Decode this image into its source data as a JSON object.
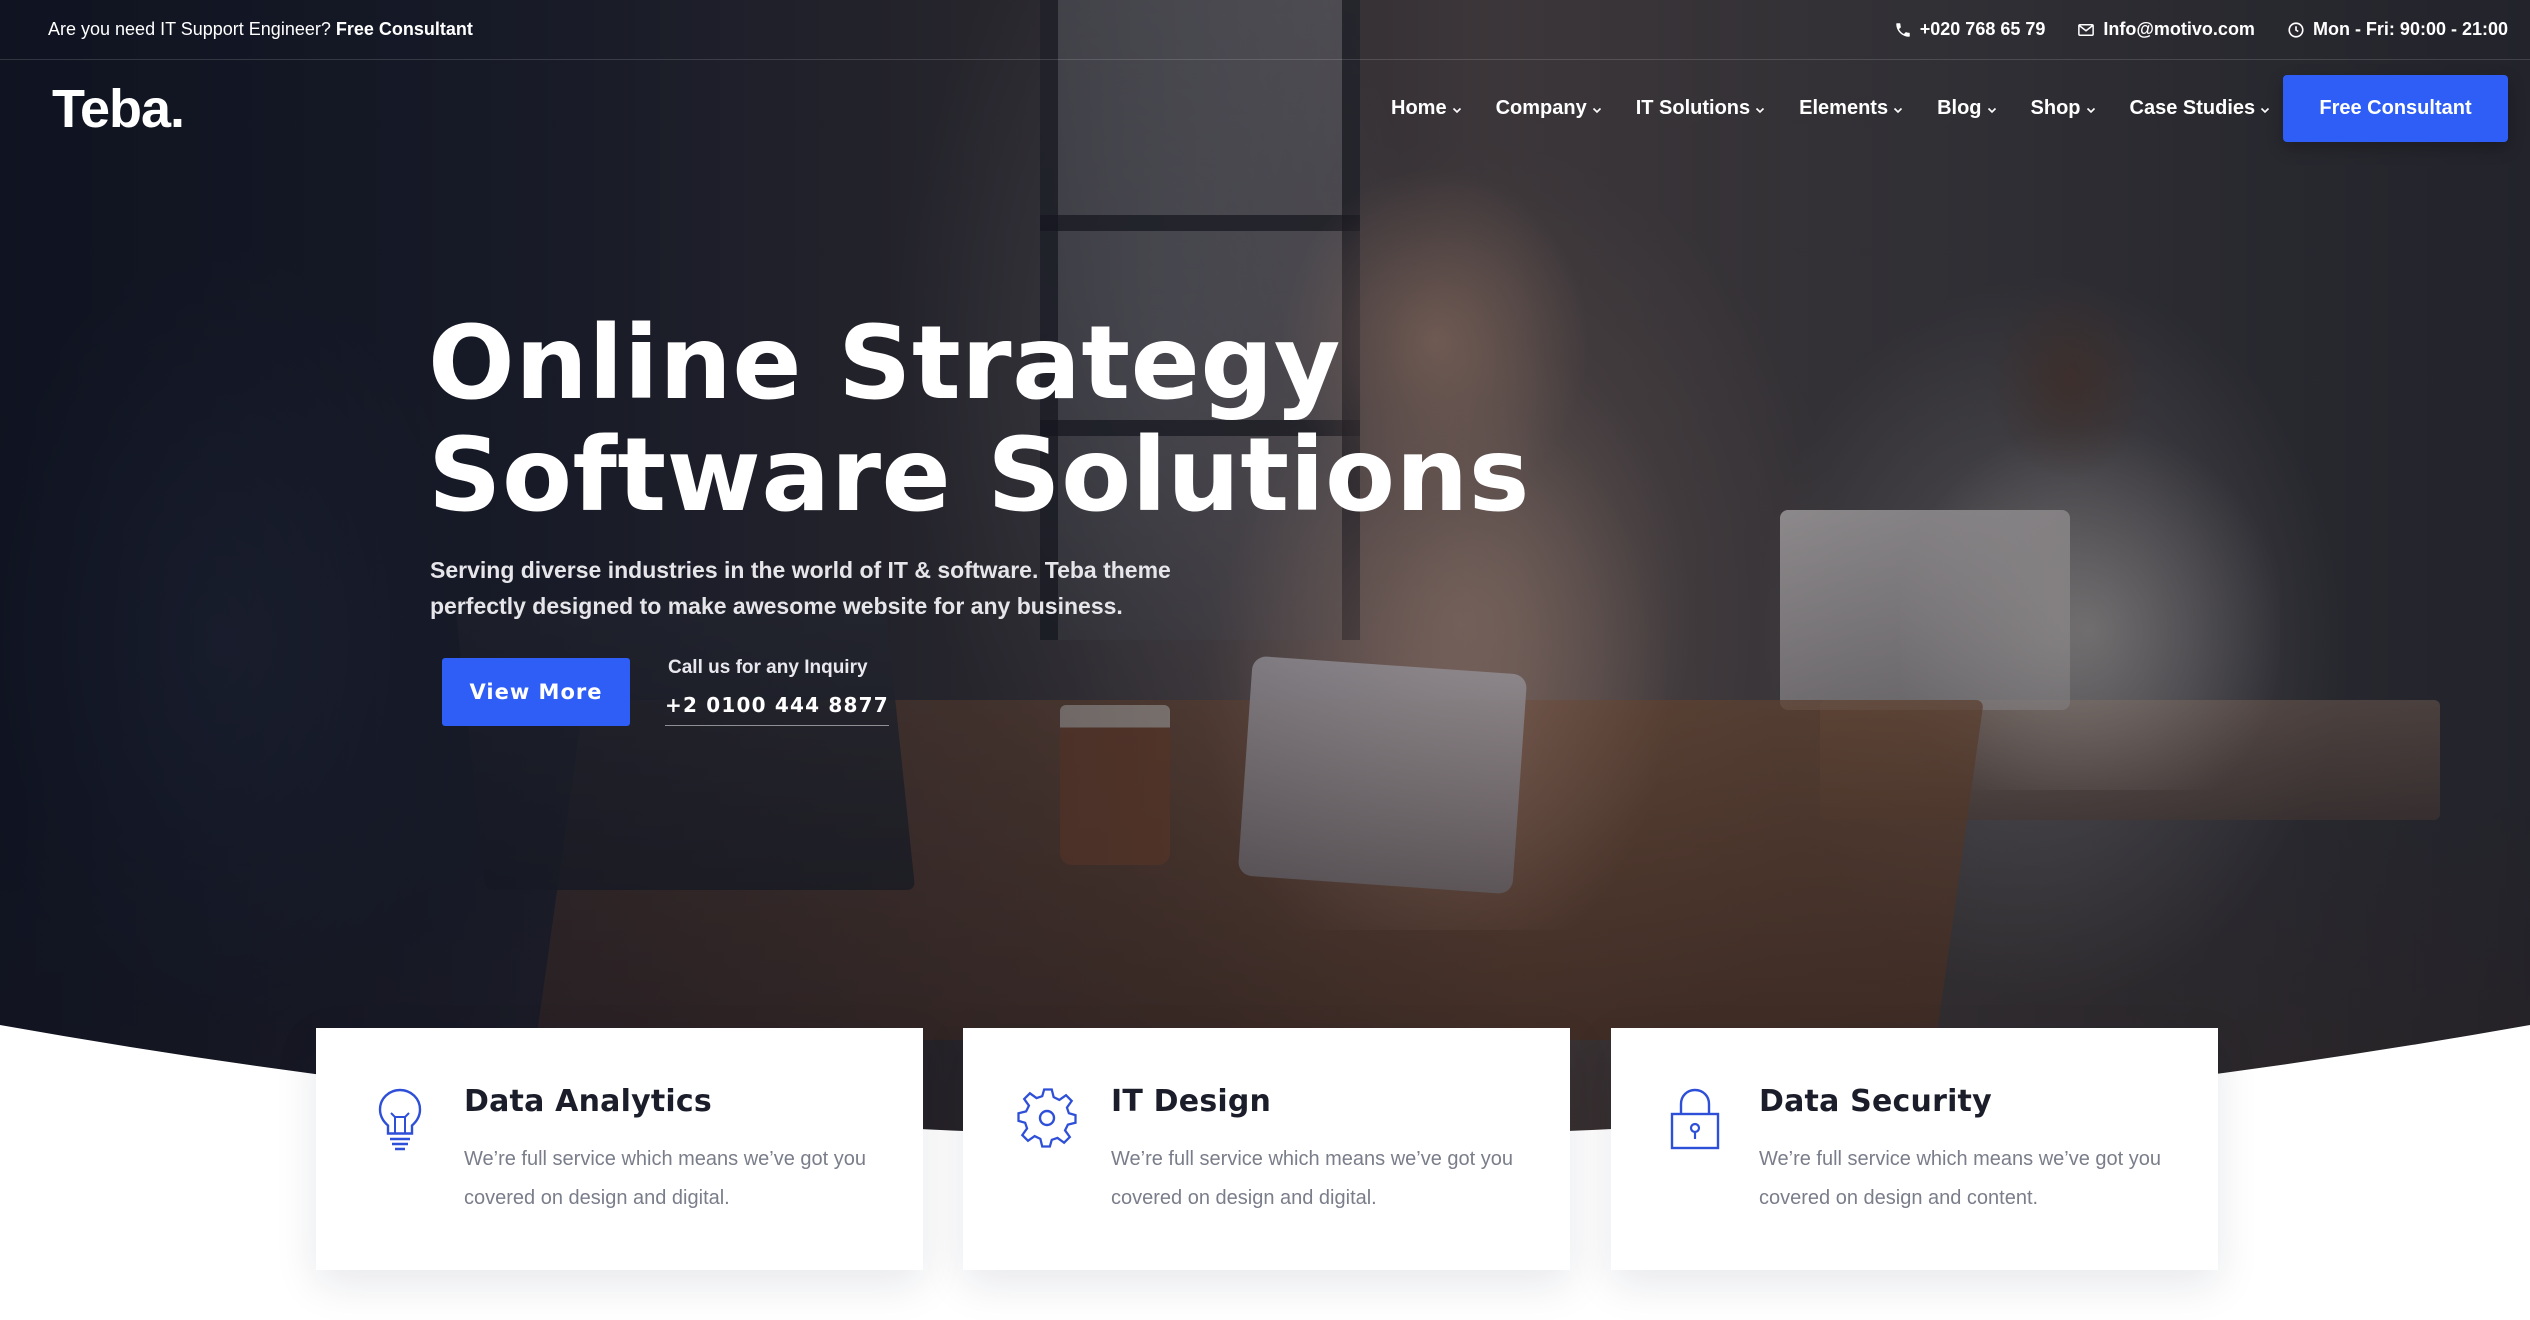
{
  "topbar": {
    "question": "Are you need IT Support Engineer?",
    "question_link": "Free Consultant",
    "phone": "+020 768 65 79",
    "email": "Info@motivo.com",
    "hours": "Mon - Fri: 90:00 - 21:00"
  },
  "brand": {
    "logo": "Teba."
  },
  "nav": {
    "items": [
      {
        "label": "Home"
      },
      {
        "label": "Company"
      },
      {
        "label": "IT Solutions"
      },
      {
        "label": "Elements"
      },
      {
        "label": "Blog"
      },
      {
        "label": "Shop"
      },
      {
        "label": "Case Studies"
      }
    ],
    "cta_label": "Free Consultant"
  },
  "hero": {
    "title_line1": "Online Strategy",
    "title_line2": "Software Solutions",
    "subtitle": "Serving diverse industries in the world of IT & software. Teba theme perfectly designed to make awesome website for any business.",
    "button_label": "View More",
    "inquiry_label": "Call us for any Inquiry",
    "inquiry_phone": "+2 0100 444 8877"
  },
  "features": [
    {
      "icon": "lightbulb-icon",
      "title": "Data Analytics",
      "text": "We’re full service which means we’ve got you covered on design and digital."
    },
    {
      "icon": "gear-icon",
      "title": "IT Design",
      "text": "We’re full service which means we’ve got you covered on design and digital."
    },
    {
      "icon": "lock-icon",
      "title": "Data Security",
      "text": "We’re full service which means we’ve got you covered on design and content."
    }
  ],
  "colors": {
    "accent": "#2e5ef5",
    "heading": "#1b1d2a",
    "body_text": "#7a7d8a",
    "icon": "#2e4fd8"
  }
}
